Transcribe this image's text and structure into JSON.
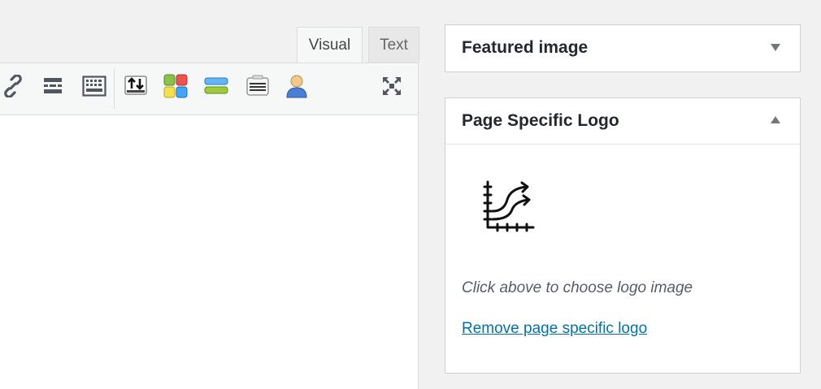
{
  "editor": {
    "tabs": [
      {
        "label": "Visual",
        "active": true
      },
      {
        "label": "Text",
        "active": false
      }
    ],
    "toolbar": {
      "buttons": [
        {
          "icon": "link-icon"
        },
        {
          "icon": "read-more-icon"
        },
        {
          "icon": "keyboard-icon"
        },
        {
          "icon": "import-export-icon"
        },
        {
          "icon": "grid-blocks-icon"
        },
        {
          "icon": "stacked-bars-icon"
        },
        {
          "icon": "text-lines-icon"
        },
        {
          "icon": "user-icon"
        },
        {
          "icon": "fullscreen-icon"
        }
      ]
    }
  },
  "sidebar": {
    "featured_image": {
      "title": "Featured image",
      "collapsed": true
    },
    "page_logo": {
      "title": "Page Specific Logo",
      "collapsed": false,
      "logo_icon": "growth-chart-icon",
      "hint": "Click above to choose logo image",
      "remove_link": "Remove page specific logo"
    }
  },
  "colors": {
    "link": "#0073aa",
    "background": "#f1f1f1"
  }
}
